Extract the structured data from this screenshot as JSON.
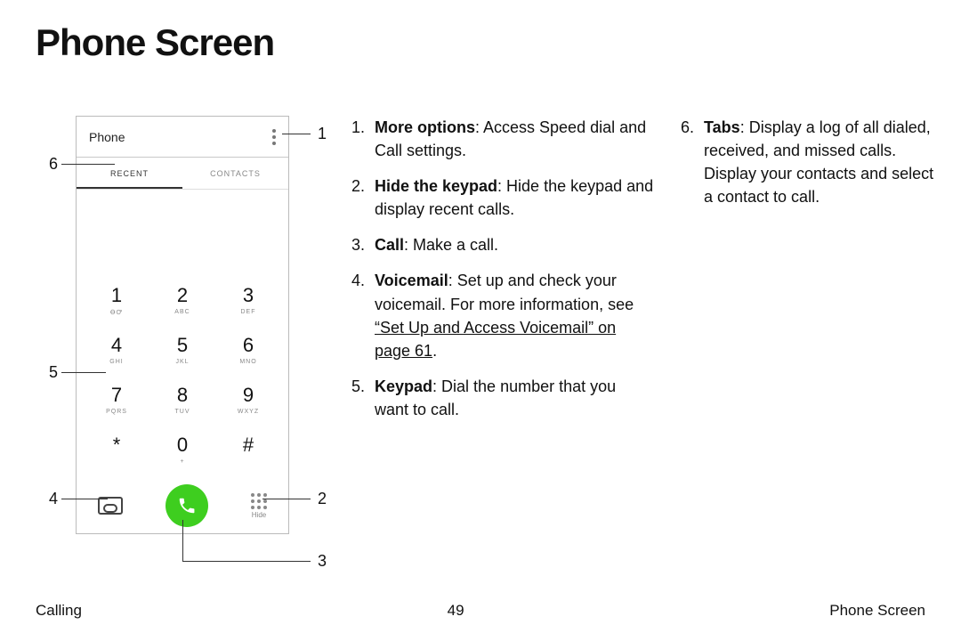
{
  "title": "Phone Screen",
  "phone": {
    "header": "Phone",
    "tab_recent": "RECENT",
    "tab_contacts": "CONTACTS",
    "keys": [
      {
        "num": "1",
        "sub": "ꝊꝌ"
      },
      {
        "num": "2",
        "sub": "ABC"
      },
      {
        "num": "3",
        "sub": "DEF"
      },
      {
        "num": "4",
        "sub": "GHI"
      },
      {
        "num": "5",
        "sub": "JKL"
      },
      {
        "num": "6",
        "sub": "MNO"
      },
      {
        "num": "7",
        "sub": "PQRS"
      },
      {
        "num": "8",
        "sub": "TUV"
      },
      {
        "num": "9",
        "sub": "WXYZ"
      },
      {
        "num": "*",
        "sub": ""
      },
      {
        "num": "0",
        "sub": "+"
      },
      {
        "num": "#",
        "sub": ""
      }
    ],
    "hide_label": "Hide"
  },
  "callouts": {
    "c1": "1",
    "c2": "2",
    "c3": "3",
    "c4": "4",
    "c5": "5",
    "c6": "6"
  },
  "list_col1": [
    {
      "n": "1.",
      "bold": "More options",
      "rest": ": Access Speed dial and Call settings."
    },
    {
      "n": "2.",
      "bold": "Hide the keypad",
      "rest": ": Hide the keypad and display recent calls."
    },
    {
      "n": "3.",
      "bold": "Call",
      "rest": ": Make a call."
    },
    {
      "n": "4.",
      "bold": "Voicemail",
      "rest": ": Set up and check your voicemail. For more information, see ",
      "link": "“Set Up and Access Voicemail” on page 61",
      "tail": "."
    },
    {
      "n": "5.",
      "bold": "Keypad",
      "rest": ": Dial the number that you want to call."
    }
  ],
  "list_col2": [
    {
      "n": "6.",
      "bold": "Tabs",
      "rest": ": Display a log of all dialed, received, and missed calls. Display your contacts and select a contact to call."
    }
  ],
  "footer": {
    "left": "Calling",
    "center": "49",
    "right": "Phone Screen"
  }
}
